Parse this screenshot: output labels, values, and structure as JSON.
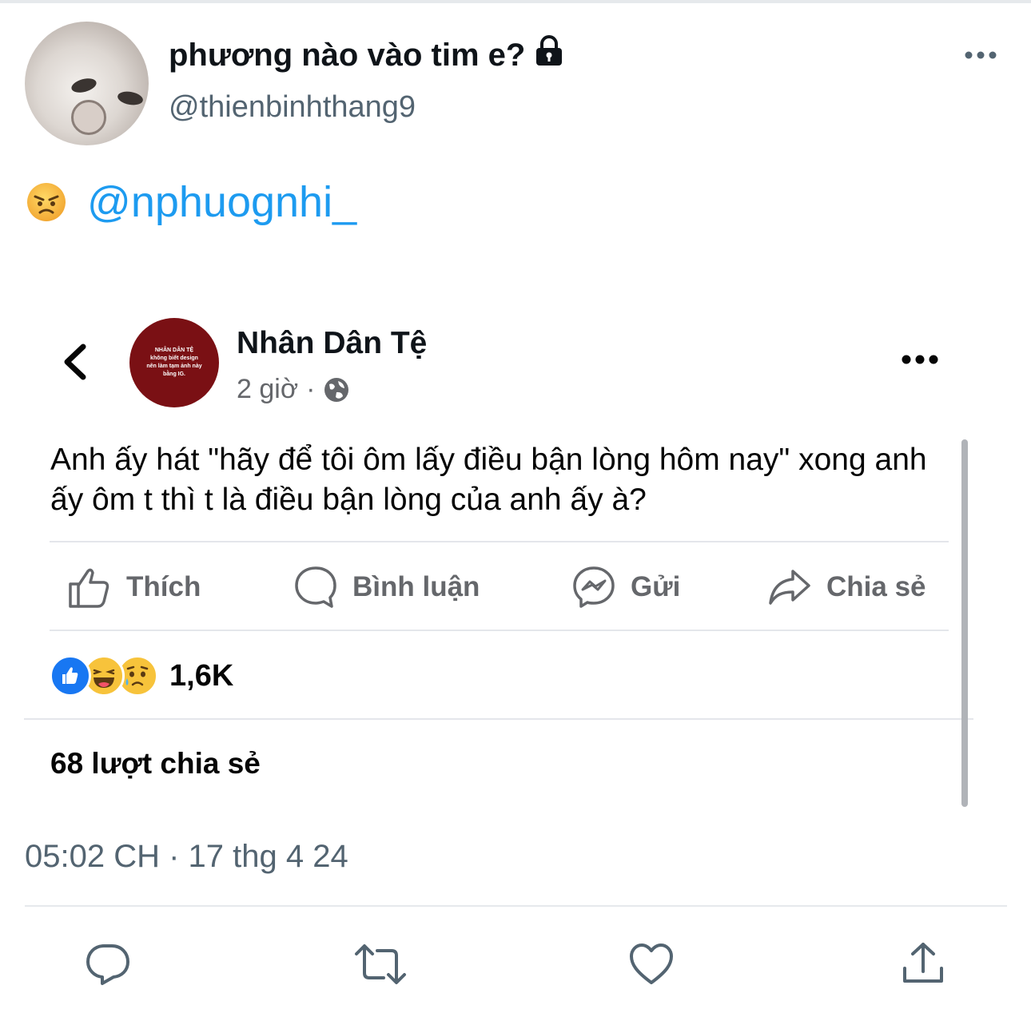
{
  "tweet": {
    "display_name": "phương nào vào tim e?",
    "handle": "@thienbinhthang9",
    "text_emoji": "angry-face",
    "mention": "@nphuognhi_",
    "timestamp": "05:02 CH · 17 thg 4 24"
  },
  "embedded_post": {
    "page_name": "Nhân Dân Tệ",
    "avatar_text": "NHÂN DÂN TỆ\nkhông biết design\nnên làm tạm ảnh này\nbằng IG.",
    "time": "2 giờ",
    "separator": "·",
    "body": "Anh ấy hát \"hãy để tôi ôm lấy điều bận lòng hôm nay\" xong anh ấy ôm t thì t là điều bận lòng của anh ấy à?",
    "actions": {
      "like": "Thích",
      "comment": "Bình luận",
      "send": "Gửi",
      "share": "Chia sẻ"
    },
    "reaction_count": "1,6K",
    "shares": "68 lượt chia sẻ"
  },
  "colors": {
    "accent": "#1d9bf0",
    "secondary_text": "#536471",
    "fb_gray": "#65676b",
    "fb_blue": "#1877f2",
    "avatar_red": "#7a1014"
  },
  "icons": [
    "lock-icon",
    "more-icon",
    "angry-face-icon",
    "back-chevron-icon",
    "globe-icon",
    "like-icon",
    "comment-icon",
    "messenger-icon",
    "share-icon",
    "reply-icon",
    "retweet-icon",
    "heart-icon",
    "upload-icon"
  ]
}
